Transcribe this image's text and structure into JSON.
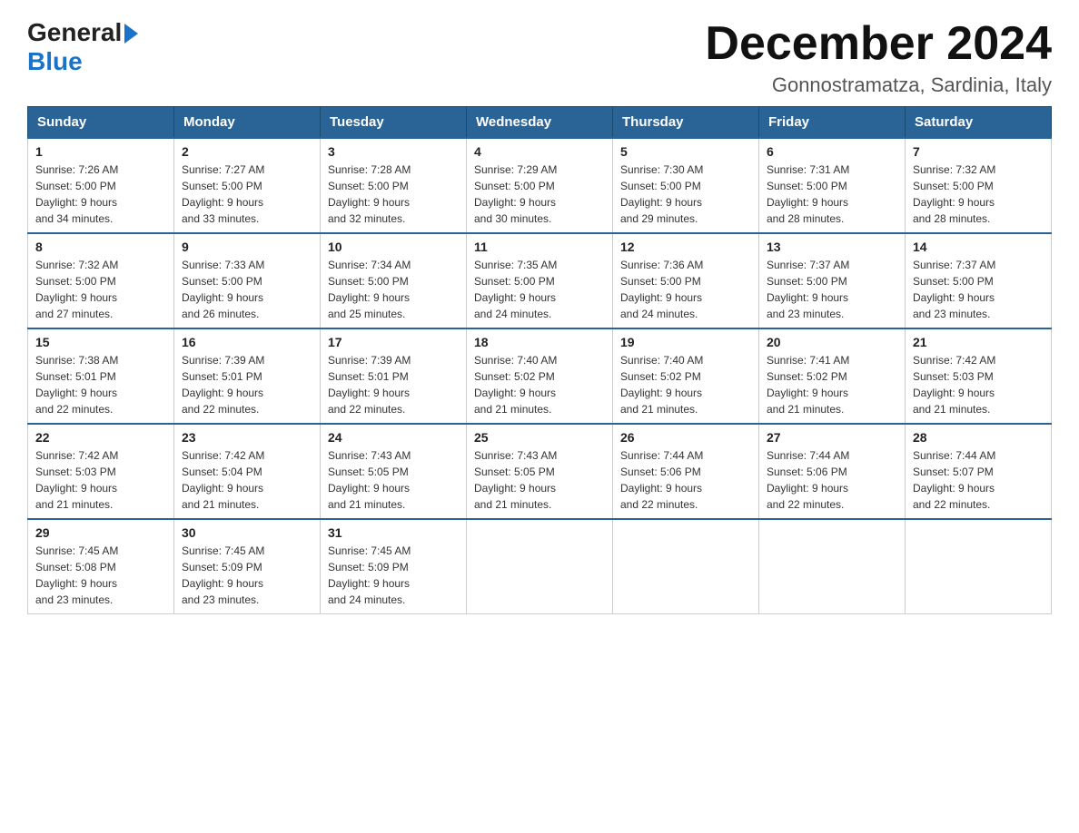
{
  "logo": {
    "general": "General",
    "blue": "Blue"
  },
  "title": "December 2024",
  "subtitle": "Gonnostramatza, Sardinia, Italy",
  "days_of_week": [
    "Sunday",
    "Monday",
    "Tuesday",
    "Wednesday",
    "Thursday",
    "Friday",
    "Saturday"
  ],
  "weeks": [
    [
      {
        "day": "1",
        "sunrise": "7:26 AM",
        "sunset": "5:00 PM",
        "daylight": "9 hours and 34 minutes."
      },
      {
        "day": "2",
        "sunrise": "7:27 AM",
        "sunset": "5:00 PM",
        "daylight": "9 hours and 33 minutes."
      },
      {
        "day": "3",
        "sunrise": "7:28 AM",
        "sunset": "5:00 PM",
        "daylight": "9 hours and 32 minutes."
      },
      {
        "day": "4",
        "sunrise": "7:29 AM",
        "sunset": "5:00 PM",
        "daylight": "9 hours and 30 minutes."
      },
      {
        "day": "5",
        "sunrise": "7:30 AM",
        "sunset": "5:00 PM",
        "daylight": "9 hours and 29 minutes."
      },
      {
        "day": "6",
        "sunrise": "7:31 AM",
        "sunset": "5:00 PM",
        "daylight": "9 hours and 28 minutes."
      },
      {
        "day": "7",
        "sunrise": "7:32 AM",
        "sunset": "5:00 PM",
        "daylight": "9 hours and 28 minutes."
      }
    ],
    [
      {
        "day": "8",
        "sunrise": "7:32 AM",
        "sunset": "5:00 PM",
        "daylight": "9 hours and 27 minutes."
      },
      {
        "day": "9",
        "sunrise": "7:33 AM",
        "sunset": "5:00 PM",
        "daylight": "9 hours and 26 minutes."
      },
      {
        "day": "10",
        "sunrise": "7:34 AM",
        "sunset": "5:00 PM",
        "daylight": "9 hours and 25 minutes."
      },
      {
        "day": "11",
        "sunrise": "7:35 AM",
        "sunset": "5:00 PM",
        "daylight": "9 hours and 24 minutes."
      },
      {
        "day": "12",
        "sunrise": "7:36 AM",
        "sunset": "5:00 PM",
        "daylight": "9 hours and 24 minutes."
      },
      {
        "day": "13",
        "sunrise": "7:37 AM",
        "sunset": "5:00 PM",
        "daylight": "9 hours and 23 minutes."
      },
      {
        "day": "14",
        "sunrise": "7:37 AM",
        "sunset": "5:00 PM",
        "daylight": "9 hours and 23 minutes."
      }
    ],
    [
      {
        "day": "15",
        "sunrise": "7:38 AM",
        "sunset": "5:01 PM",
        "daylight": "9 hours and 22 minutes."
      },
      {
        "day": "16",
        "sunrise": "7:39 AM",
        "sunset": "5:01 PM",
        "daylight": "9 hours and 22 minutes."
      },
      {
        "day": "17",
        "sunrise": "7:39 AM",
        "sunset": "5:01 PM",
        "daylight": "9 hours and 22 minutes."
      },
      {
        "day": "18",
        "sunrise": "7:40 AM",
        "sunset": "5:02 PM",
        "daylight": "9 hours and 21 minutes."
      },
      {
        "day": "19",
        "sunrise": "7:40 AM",
        "sunset": "5:02 PM",
        "daylight": "9 hours and 21 minutes."
      },
      {
        "day": "20",
        "sunrise": "7:41 AM",
        "sunset": "5:02 PM",
        "daylight": "9 hours and 21 minutes."
      },
      {
        "day": "21",
        "sunrise": "7:42 AM",
        "sunset": "5:03 PM",
        "daylight": "9 hours and 21 minutes."
      }
    ],
    [
      {
        "day": "22",
        "sunrise": "7:42 AM",
        "sunset": "5:03 PM",
        "daylight": "9 hours and 21 minutes."
      },
      {
        "day": "23",
        "sunrise": "7:42 AM",
        "sunset": "5:04 PM",
        "daylight": "9 hours and 21 minutes."
      },
      {
        "day": "24",
        "sunrise": "7:43 AM",
        "sunset": "5:05 PM",
        "daylight": "9 hours and 21 minutes."
      },
      {
        "day": "25",
        "sunrise": "7:43 AM",
        "sunset": "5:05 PM",
        "daylight": "9 hours and 21 minutes."
      },
      {
        "day": "26",
        "sunrise": "7:44 AM",
        "sunset": "5:06 PM",
        "daylight": "9 hours and 22 minutes."
      },
      {
        "day": "27",
        "sunrise": "7:44 AM",
        "sunset": "5:06 PM",
        "daylight": "9 hours and 22 minutes."
      },
      {
        "day": "28",
        "sunrise": "7:44 AM",
        "sunset": "5:07 PM",
        "daylight": "9 hours and 22 minutes."
      }
    ],
    [
      {
        "day": "29",
        "sunrise": "7:45 AM",
        "sunset": "5:08 PM",
        "daylight": "9 hours and 23 minutes."
      },
      {
        "day": "30",
        "sunrise": "7:45 AM",
        "sunset": "5:09 PM",
        "daylight": "9 hours and 23 minutes."
      },
      {
        "day": "31",
        "sunrise": "7:45 AM",
        "sunset": "5:09 PM",
        "daylight": "9 hours and 24 minutes."
      },
      null,
      null,
      null,
      null
    ]
  ],
  "labels": {
    "sunrise": "Sunrise:",
    "sunset": "Sunset:",
    "daylight": "Daylight:"
  },
  "colors": {
    "header_bg": "#2a6496",
    "header_text": "#ffffff",
    "border": "#2a6496"
  }
}
